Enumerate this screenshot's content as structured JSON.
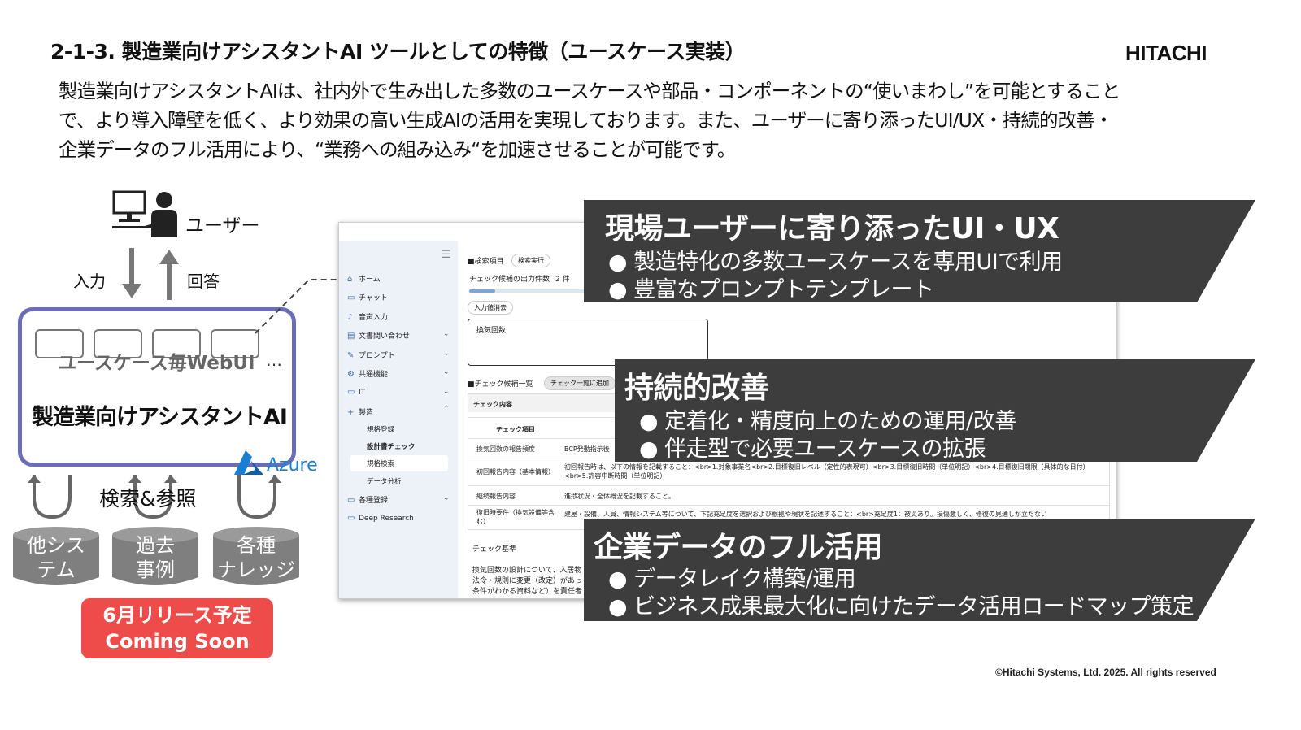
{
  "header": {
    "title": "2-1-3. 製造業向けアシスタントAI ツールとしての特徴（ユースケース実装）",
    "logo": "HITACHI"
  },
  "intro": {
    "line1": "製造業向けアシスタントAIは、社内外で生み出した多数のユースケースや部品・コンポーネントの“使いまわし”を可能とすること",
    "line2": "で、より導入障壁を低く、より効果の高い生成AIの活用を実現しております。また、ユーザーに寄り添ったUI/UX・持続的改善・",
    "line3": "企業データのフル活用により、“業務への組み込み“を加速させることが可能です。"
  },
  "diagram": {
    "user_label": "ユーザー",
    "input_label": "入力",
    "answer_label": "回答",
    "webui_label": "ユースケース毎WebUI",
    "ellipsis": "…",
    "ai_name": "製造業向けアシスタントAI",
    "azure_label": "Azure",
    "search_label": "検索&参照",
    "databases": [
      {
        "line1": "他シス",
        "line2": "テム"
      },
      {
        "line1": "過去",
        "line2": "事例"
      },
      {
        "line1": "各種",
        "line2": "ナレッジ"
      }
    ],
    "release": {
      "line1": "6月リリース予定",
      "line2": "Coming Soon"
    }
  },
  "app_screen": {
    "nav": [
      {
        "label": "ホーム",
        "icon": "⌂"
      },
      {
        "label": "チャット",
        "icon": "▭"
      },
      {
        "label": "音声入力",
        "icon": "♪"
      },
      {
        "label": "文書問い合わせ",
        "icon": "▤"
      },
      {
        "label": "プロンプト",
        "icon": "✎"
      },
      {
        "label": "共通機能",
        "icon": "⚙"
      },
      {
        "label": "IT",
        "icon": "▭"
      },
      {
        "label": "製造",
        "icon": "+"
      },
      {
        "label": "各種登録",
        "icon": "▭"
      },
      {
        "label": "Deep Research",
        "icon": "▭"
      }
    ],
    "sub_nav": [
      "規格登録",
      "設計書チェック",
      "規格検索",
      "データ分析"
    ],
    "search_section": "■検索項目",
    "search_button": "検索実行",
    "count_label": "チェック候補の出力件数",
    "count_value": "2 件",
    "clear_button": "入力値消去",
    "query_value": "換気回数",
    "list_section": "■チェック候補一覧",
    "add_button": "チェック一覧に追加",
    "table_header": "チェック内容",
    "col_item": "チェック項目",
    "rows": [
      {
        "item": "換気回数の報告頻度",
        "content": "BCP発動指示後"
      },
      {
        "item": "初回報告内容（基本情報）",
        "content": "初回報告時は、以下の情報を記載すること：<br>1.対象事業名<br>2.目標復旧レベル（定性的表現可）<br>3.目標復旧時間（単位明記）<br>4.目標復旧期限（具体的な日付）<br>5.許容中断時間（単位明記）"
      },
      {
        "item": "継続報告内容",
        "content": "進捗状況・全体概況を記載すること。"
      },
      {
        "item": "復旧時要件（換気設備等含む）",
        "content": "建屋・設備、人員、情報システム等について、下記充足度を選択および根拠や現状を記述すること：<br>充足度1：被災あり。損傷激しく、修復の見通しが立たない"
      }
    ],
    "criteria_label": "チェック基準",
    "criteria_text1": "換気回数の設計について、入居物",
    "criteria_text2": "法令・規則に変更（改定）があっ",
    "criteria_text3": "条件がわかる資料など）を責任者"
  },
  "callouts": [
    {
      "title": "現場ユーザーに寄り添ったUI・UX",
      "items": [
        "製造特化の多数ユースケースを専用UIで利用",
        "豊富なプロンプトテンプレート"
      ]
    },
    {
      "title": "持続的改善",
      "items": [
        "定着化・精度向上のための運用/改善",
        "伴走型で必要ユースケースの拡張"
      ]
    },
    {
      "title": "企業データのフル活用",
      "items": [
        "データレイク構築/運用",
        "ビジネス成果最大化に向けたデータ活用ロードマップ策定"
      ]
    }
  ],
  "bullet": "●",
  "footer": {
    "copyright": "©Hitachi Systems, Ltd. 2025. All rights reserved"
  },
  "colors": {
    "callout_bg": "#3d3d3d",
    "ai_border": "#6b6db8",
    "release_bg": "#ee4b4b",
    "db_fill": "#7f7f7f",
    "azure": "#1a7fd1"
  }
}
